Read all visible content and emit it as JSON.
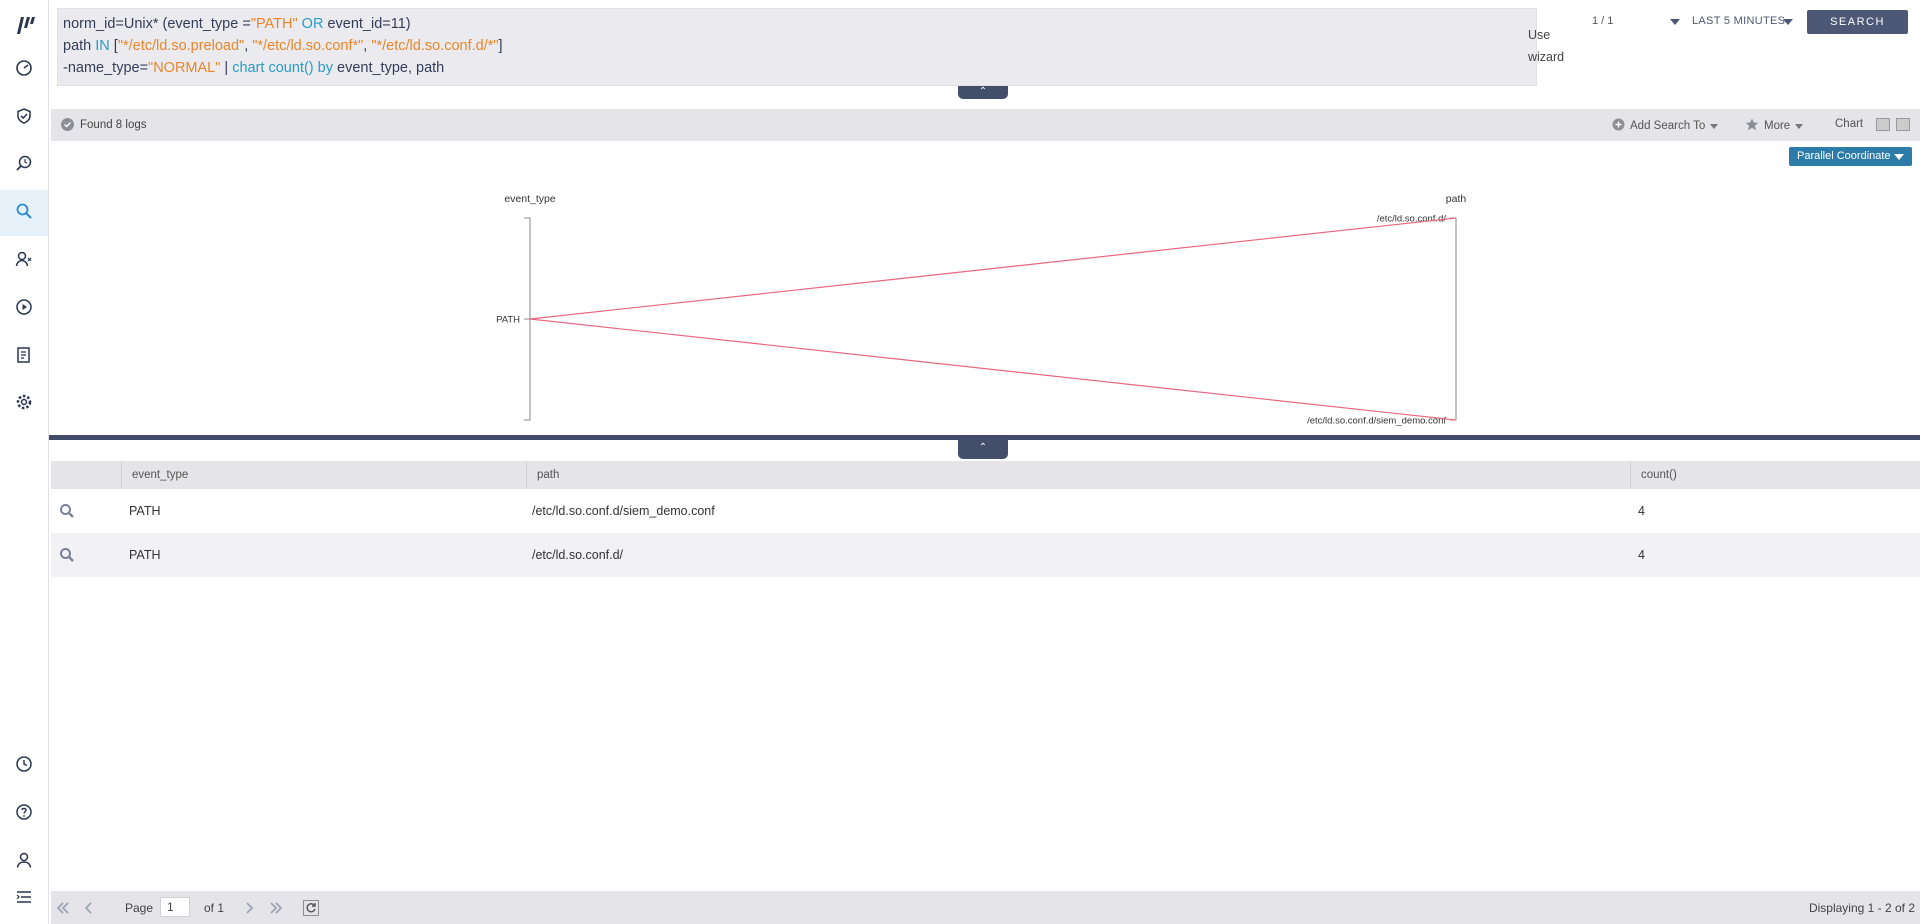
{
  "sidebar": {
    "logo": "logpoint-logo",
    "items": [
      {
        "icon": "dashboard-icon"
      },
      {
        "icon": "shield-check-icon"
      },
      {
        "icon": "search-history-icon"
      },
      {
        "icon": "search-icon",
        "active": true
      },
      {
        "icon": "users-icon"
      },
      {
        "icon": "play-icon"
      },
      {
        "icon": "reports-icon"
      },
      {
        "icon": "gear-icon"
      }
    ],
    "bottom_items": [
      {
        "icon": "clock-icon"
      },
      {
        "icon": "help-icon"
      },
      {
        "icon": "user-icon"
      },
      {
        "icon": "menu-icon"
      }
    ]
  },
  "query": {
    "line1": [
      {
        "t": "norm_id=Unix* (event_type =",
        "c": "plain"
      },
      {
        "t": "\"PATH\"",
        "c": "str"
      },
      {
        "t": " OR ",
        "c": "kw"
      },
      {
        "t": "event_id=11)",
        "c": "plain"
      }
    ],
    "line2": [
      {
        "t": "path ",
        "c": "plain"
      },
      {
        "t": "IN",
        "c": "kw"
      },
      {
        "t": " [",
        "c": "plain"
      },
      {
        "t": "\"*/etc/ld.so.preload\"",
        "c": "str"
      },
      {
        "t": ", ",
        "c": "plain"
      },
      {
        "t": "\"*/etc/ld.so.conf*\"",
        "c": "str"
      },
      {
        "t": ", ",
        "c": "plain"
      },
      {
        "t": "\"*/etc/ld.so.conf.d/*\"",
        "c": "str"
      },
      {
        "t": "]",
        "c": "plain"
      }
    ],
    "line3": [
      {
        "t": "-name_type=",
        "c": "plain"
      },
      {
        "t": "\"NORMAL\"",
        "c": "str"
      },
      {
        "t": " | ",
        "c": "plain"
      },
      {
        "t": "chart count()",
        "c": "kw"
      },
      {
        "t": " ",
        "c": "plain"
      },
      {
        "t": "by",
        "c": "kw"
      },
      {
        "t": " event_type, path",
        "c": "plain"
      }
    ]
  },
  "header": {
    "use_wizard": "Use wizard",
    "page_count": "1 / 1",
    "time_range": "LAST 5 MINUTES",
    "search_label": "SEARCH"
  },
  "results_bar": {
    "found": "Found 8 logs",
    "add_search_to": "Add Search To",
    "more": "More",
    "chart": "Chart"
  },
  "chart_select": "Parallel Coordinate",
  "chart_data": {
    "type": "parallel_coordinates",
    "axes": [
      "event_type",
      "path"
    ],
    "axis_ticks": {
      "event_type": [
        "PATH"
      ],
      "path": [
        "/etc/ld.so.conf.d/",
        "/etc/ld.so.conf.d/siem_demo.conf"
      ]
    },
    "lines": [
      {
        "event_type": "PATH",
        "path": "/etc/ld.so.conf.d/"
      },
      {
        "event_type": "PATH",
        "path": "/etc/ld.so.conf.d/siem_demo.conf"
      }
    ],
    "line_color": "#e8677f"
  },
  "table": {
    "columns": [
      "",
      "event_type",
      "path",
      "count()"
    ],
    "rows": [
      {
        "event_type": "PATH",
        "path": "/etc/ld.so.conf.d/siem_demo.conf",
        "count": "4"
      },
      {
        "event_type": "PATH",
        "path": "/etc/ld.so.conf.d/",
        "count": "4"
      }
    ]
  },
  "pager": {
    "page_label": "Page",
    "page_value": "1",
    "of_label": "of 1",
    "displaying": "Displaying 1 - 2 of 2"
  },
  "colors": {
    "accent": "#4c5876",
    "chart_select": "#2c7ba8",
    "string": "#e8862a",
    "keyword": "#2a9bc6"
  }
}
